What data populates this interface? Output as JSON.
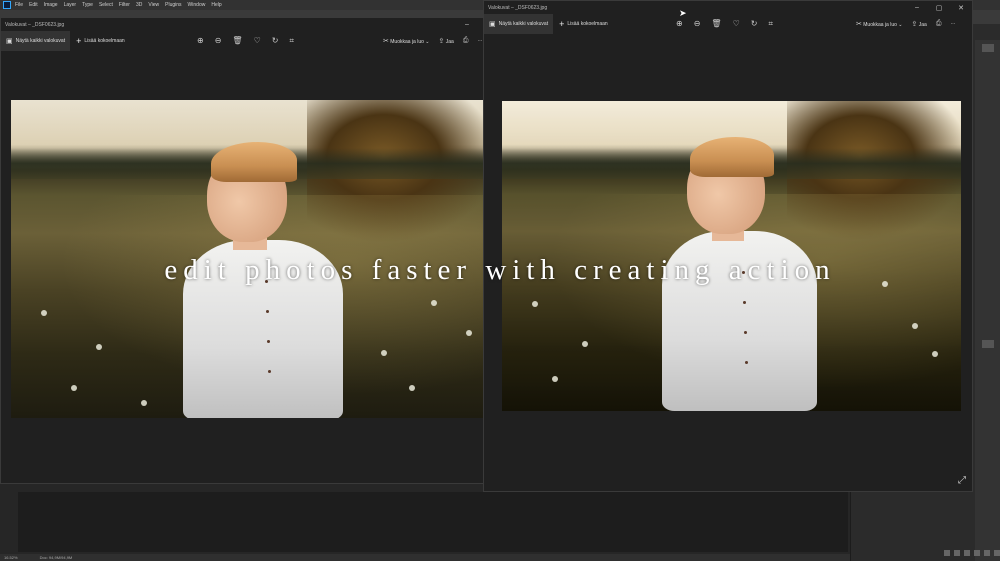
{
  "photoshop": {
    "menu": [
      "File",
      "Edit",
      "Image",
      "Layer",
      "Type",
      "Select",
      "Filter",
      "3D",
      "View",
      "Plugins",
      "Window",
      "Help"
    ],
    "status": {
      "zoom": "16.52%",
      "doc": "Doc: 94,9M/94,9M"
    }
  },
  "left_viewer": {
    "title": "Valokuvat – _DSF0623.jpg",
    "see_all": "Näytä kaikki valokuvat",
    "add_collection": "Lisää kokoelmaan",
    "edit_create": "Muokkaa ja luo",
    "share": "Jaa",
    "more": "···"
  },
  "right_viewer": {
    "title": "Valokuvat – _DSF0623.jpg",
    "see_all": "Näytä kaikki valokuvat",
    "add_collection": "Lisää kokoelmaan",
    "edit_create": "Muokkaa ja luo",
    "share": "Jaa",
    "more": "···"
  },
  "window_controls": {
    "minimize": "–",
    "maximize": "▢",
    "close": "✕"
  },
  "tool_icons": [
    "zoom-in-icon",
    "zoom-out-icon",
    "delete-icon",
    "heart-icon",
    "rotate-icon",
    "crop-icon"
  ],
  "caption": "edit photos faster with creating action"
}
